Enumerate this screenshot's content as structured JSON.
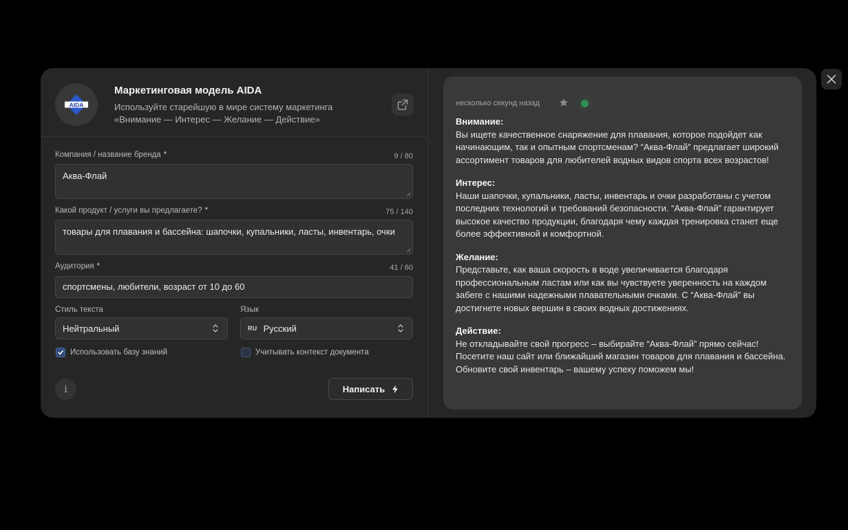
{
  "header": {
    "logo_text": "AIDA",
    "title": "Маркетинговая модель AIDA",
    "subtitle": "Используйте старейшую в мире систему маркетинга «Внимание — Интерес — Желание — Действие»"
  },
  "form": {
    "required_mark": "*",
    "company": {
      "label": "Компания / название бренда",
      "value": "Аква-Флай",
      "counter": "9 / 80"
    },
    "product": {
      "label": "Какой продукт / услуги вы предлагаете?",
      "value": "товары для плавания и бассейна: шапочки, купальники, ласты, инвентарь, очки",
      "counter": "75 / 140"
    },
    "audience": {
      "label": "Аудитория",
      "value": "спортсмены, любители, возраст от 10 до 60",
      "counter": "41 / 60"
    },
    "style": {
      "label": "Стиль текста",
      "value": "Нейтральный"
    },
    "language": {
      "label": "Язык",
      "code": "RU",
      "value": "Русский"
    },
    "use_knowledge_base": {
      "label": "Использовать базу знаний",
      "checked": true
    },
    "use_document_context": {
      "label": "Учитывать контекст документа",
      "checked": false
    },
    "submit_label": "Написать"
  },
  "result": {
    "timestamp": "несколько секунд назад",
    "sections": [
      {
        "title": "Внимание:",
        "text": "Вы ищете качественное снаряжение для плавания, которое подойдет как начинающим, так и опытным спортсменам? “Аква-Флай” предлагает широкий ассортимент товаров для любителей водных видов спорта всех возрастов!"
      },
      {
        "title": "Интерес:",
        "text": "Наши шапочки, купальники, ласты, инвентарь и очки разработаны с учетом последних технологий и требований безопасности. “Аква-Флай” гарантирует высокое качество продукции, благодаря чему каждая тренировка станет еще более эффективной и комфортной."
      },
      {
        "title": "Желание:",
        "text": "Представьте, как ваша скорость в воде увеличивается благодаря профессиональным ластам или как вы чувствуете уверенность на каждом забеге с нашими надежными плавательными очками. С “Аква-Флай” вы достигнете новых вершин в своих водных достижениях."
      },
      {
        "title": "Действие:",
        "text": "Не откладывайте свой прогресс – выбирайте “Аква-Флай” прямо сейчас! Посетите наш сайт или ближайший магазин товаров для плавания и бассейна. Обновите свой инвентарь – вашему успеху поможем мы!"
      }
    ]
  },
  "colors": {
    "background": "#000000",
    "modal": "#262626",
    "card": "#393939",
    "accent_blue": "#2f4a78",
    "status_green": "#2f8f57"
  }
}
